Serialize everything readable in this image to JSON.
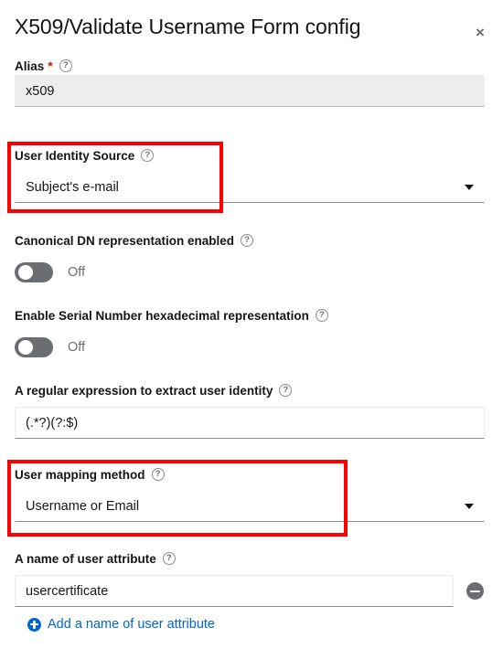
{
  "dialog": {
    "title": "X509/Validate Username Form config",
    "close_label": "×",
    "close_icon": "close-icon"
  },
  "help_icon_glyph": "?",
  "fields": {
    "alias": {
      "label": "Alias",
      "required_marker": "*",
      "value": "x509",
      "readonly": true,
      "help_icon": "help-circle-icon"
    },
    "user_identity_source": {
      "label": "User Identity Source",
      "value": "Subject's e-mail",
      "help_icon": "help-circle-icon",
      "highlighted": true
    },
    "canonical_dn": {
      "label": "Canonical DN representation enabled",
      "state_label": "Off",
      "checked": false,
      "help_icon": "help-circle-icon"
    },
    "serial_hex": {
      "label": "Enable Serial Number hexadecimal representation",
      "state_label": "Off",
      "checked": false,
      "help_icon": "help-circle-icon"
    },
    "regex": {
      "label": "A regular expression to extract user identity",
      "value": "(.*?)(?:$)",
      "help_icon": "help-circle-icon"
    },
    "user_mapping_method": {
      "label": "User mapping method",
      "value": "Username or Email",
      "help_icon": "help-circle-icon",
      "highlighted": true
    },
    "user_attribute": {
      "label": "A name of user attribute",
      "value": "usercertificate",
      "help_icon": "help-circle-icon",
      "remove_icon": "minus-circle-icon",
      "add_link_label": "Add a name of user attribute",
      "add_icon": "plus-circle-icon"
    }
  },
  "colors": {
    "highlight": "#ff0000",
    "link": "#0066cc",
    "required": "#c9190b",
    "toggle_off": "#6a6e73",
    "text": "#151515",
    "muted": "#6a6e73",
    "readonly_bg": "#ededed"
  }
}
